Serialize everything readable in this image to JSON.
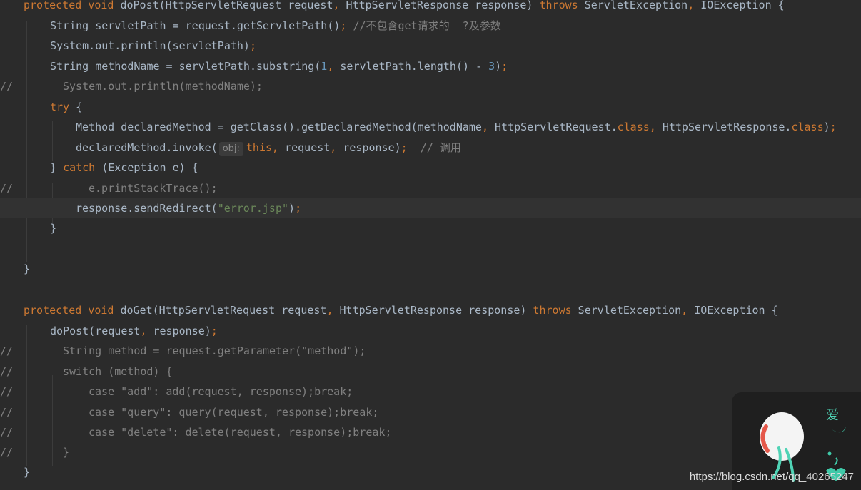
{
  "editor": {
    "lines": [
      {
        "segments": [
          {
            "t": "protected ",
            "c": "kw"
          },
          {
            "t": "void ",
            "c": "kw"
          },
          {
            "t": "doPost(HttpServletRequest request",
            "c": ""
          },
          {
            "t": ", ",
            "c": "kw"
          },
          {
            "t": "HttpServletResponse response) ",
            "c": ""
          },
          {
            "t": "throws ",
            "c": "kw"
          },
          {
            "t": "ServletException",
            "c": ""
          },
          {
            "t": ", ",
            "c": "kw"
          },
          {
            "t": "IOException {",
            "c": ""
          }
        ]
      },
      {
        "segments": [
          {
            "t": "String servletPath = request.getServletPath()",
            "c": ""
          },
          {
            "t": "; ",
            "c": "kw"
          },
          {
            "t": "//不包含get请求的  ?及参数",
            "c": "cmt"
          }
        ]
      },
      {
        "segments": [
          {
            "t": "System.out.println(servletPath)",
            "c": ""
          },
          {
            "t": ";",
            "c": "kw"
          }
        ]
      },
      {
        "segments": [
          {
            "t": "String methodName = servletPath.substring(",
            "c": ""
          },
          {
            "t": "1",
            "c": "num"
          },
          {
            "t": ", ",
            "c": "kw"
          },
          {
            "t": "servletPath.length() - ",
            "c": ""
          },
          {
            "t": "3",
            "c": "num"
          },
          {
            "t": ")",
            "c": ""
          },
          {
            "t": ";",
            "c": "kw"
          }
        ]
      },
      {
        "comment_marker": "//",
        "segments": [
          {
            "t": "System.out.println(methodName);",
            "c": "cmt"
          }
        ]
      },
      {
        "segments": [
          {
            "t": "try ",
            "c": "kw"
          },
          {
            "t": "{",
            "c": ""
          }
        ]
      },
      {
        "segments": [
          {
            "t": "Method declaredMethod = getClass().getDeclaredMethod(methodName",
            "c": ""
          },
          {
            "t": ", ",
            "c": "kw"
          },
          {
            "t": "HttpServletRequest.",
            "c": ""
          },
          {
            "t": "class",
            "c": "kw"
          },
          {
            "t": ", ",
            "c": "kw"
          },
          {
            "t": "HttpServletResponse.",
            "c": ""
          },
          {
            "t": "class",
            "c": "kw"
          },
          {
            "t": ")",
            "c": ""
          },
          {
            "t": ";",
            "c": "kw"
          }
        ]
      },
      {
        "segments": [
          {
            "t": "declaredMethod.invoke(",
            "c": ""
          },
          {
            "hint": "obj:"
          },
          {
            "t": "this",
            "c": "kw"
          },
          {
            "t": ", ",
            "c": "kw"
          },
          {
            "t": "request",
            "c": ""
          },
          {
            "t": ", ",
            "c": "kw"
          },
          {
            "t": "response)",
            "c": ""
          },
          {
            "t": ";  ",
            "c": "kw"
          },
          {
            "t": "// 调用",
            "c": "cmt"
          }
        ]
      },
      {
        "segments": [
          {
            "t": "} ",
            "c": ""
          },
          {
            "t": "catch ",
            "c": "kw"
          },
          {
            "t": "(Exception e) {",
            "c": ""
          }
        ]
      },
      {
        "comment_marker": "//",
        "segments": [
          {
            "t": "e.printStackTrace();",
            "c": "cmt"
          }
        ]
      },
      {
        "current": true,
        "segments": [
          {
            "t": "response.sendRedirect(",
            "c": ""
          },
          {
            "t": "\"error.jsp\"",
            "c": "str"
          },
          {
            "t": ")",
            "c": ""
          },
          {
            "t": ";",
            "c": "kw"
          }
        ]
      },
      {
        "segments": [
          {
            "t": "}",
            "c": ""
          }
        ]
      },
      {
        "segments": []
      },
      {
        "segments": [
          {
            "t": "}",
            "c": ""
          }
        ]
      },
      {
        "segments": []
      },
      {
        "segments": [
          {
            "t": "protected ",
            "c": "kw"
          },
          {
            "t": "void ",
            "c": "kw"
          },
          {
            "t": "doGet(HttpServletRequest request",
            "c": ""
          },
          {
            "t": ", ",
            "c": "kw"
          },
          {
            "t": "HttpServletResponse response) ",
            "c": ""
          },
          {
            "t": "throws ",
            "c": "kw"
          },
          {
            "t": "ServletException",
            "c": ""
          },
          {
            "t": ", ",
            "c": "kw"
          },
          {
            "t": "IOException {",
            "c": ""
          }
        ]
      },
      {
        "segments": [
          {
            "t": "doPost(request",
            "c": ""
          },
          {
            "t": ", ",
            "c": "kw"
          },
          {
            "t": "response)",
            "c": ""
          },
          {
            "t": ";",
            "c": "kw"
          }
        ]
      },
      {
        "comment_marker": "//",
        "segments": [
          {
            "t": "String method = request.getParameter(\"method\");",
            "c": "cmt"
          }
        ]
      },
      {
        "comment_marker": "//",
        "segments": [
          {
            "t": "switch (method) {",
            "c": "cmt"
          }
        ]
      },
      {
        "comment_marker": "//",
        "segments": [
          {
            "t": "case \"add\": add(request, response);break;",
            "c": "cmt"
          }
        ]
      },
      {
        "comment_marker": "//",
        "segments": [
          {
            "t": "case \"query\": query(request, response);break;",
            "c": "cmt"
          }
        ]
      },
      {
        "comment_marker": "//",
        "segments": [
          {
            "t": "case \"delete\": delete(request, response);break;",
            "c": "cmt"
          }
        ]
      },
      {
        "comment_marker": "//",
        "segments": [
          {
            "t": "}",
            "c": "cmt"
          }
        ]
      },
      {
        "segments": [
          {
            "t": "}",
            "c": ""
          }
        ]
      }
    ]
  },
  "watermark": "https://blog.csdn.net/qq_40265247",
  "colors": {
    "background": "#2b2b2b",
    "default_text": "#a9b7c6",
    "keyword": "#cc7832",
    "number": "#6897bb",
    "string": "#6a8759",
    "comment": "#808080",
    "current_line": "#323232"
  },
  "icons": [
    "mascot-icon",
    "decoration-icon"
  ]
}
